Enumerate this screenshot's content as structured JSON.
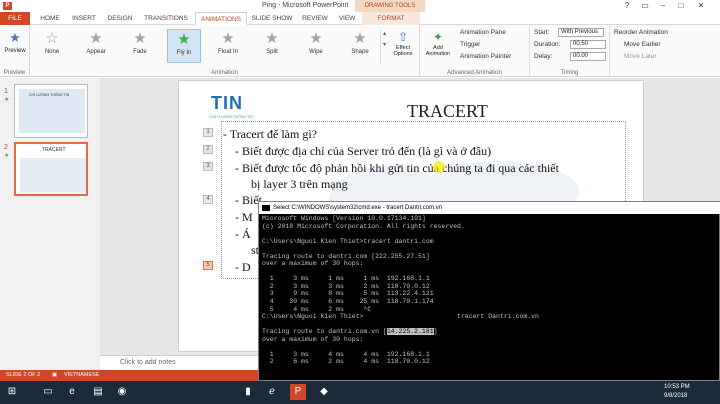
{
  "window": {
    "title": "Ping - Microsoft PowerPoint",
    "context_tab_group": "DRAWING TOOLS",
    "controls": {
      "help": "?",
      "restore": "▭",
      "minimize": "–",
      "maximize": "□",
      "close": "✕"
    }
  },
  "tabs": [
    "FILE",
    "HOME",
    "INSERT",
    "DESIGN",
    "TRANSITIONS",
    "ANIMATIONS",
    "SLIDE SHOW",
    "REVIEW",
    "VIEW",
    "FORMAT"
  ],
  "ribbon": {
    "preview": {
      "label": "Preview",
      "group": "Preview"
    },
    "animations": [
      "None",
      "Appear",
      "Fade",
      "Fly In",
      "Float In",
      "Split",
      "Wipe",
      "Shape"
    ],
    "selected_animation": "Fly In",
    "effect_options": "Effect Options",
    "animation_group": "Animation",
    "add_animation": "Add Animation",
    "animation_pane": "Animation Pane",
    "trigger": "Trigger",
    "animation_painter": "Animation Painter",
    "advanced_group": "Advanced Animation",
    "start_label": "Start:",
    "start_value": "With Previous",
    "duration_label": "Duration:",
    "duration_value": "00.50",
    "delay_label": "Delay:",
    "delay_value": "00.00",
    "reorder_label": "Reorder Animation",
    "move_earlier": "Move Earlier",
    "move_later": "Move Later",
    "timing_group": "Timing"
  },
  "thumbnails": [
    {
      "number": "1",
      "marker": "★",
      "title": "CHỈ LƯỜNG THÔNG TIN"
    },
    {
      "number": "2",
      "marker": "★",
      "title": "TRACERT"
    }
  ],
  "slide": {
    "title": "TRACERT",
    "logo_text": "TIN",
    "logo_caption": "CHẤT LƯỢNG THÔNG TIN",
    "bullets": [
      "-  Tracert để làm gì?",
      "-  Biết được địa chỉ của Server trỏ đến (là gì và ở đâu)",
      "-  Biết được tốc độ phản hồi khi gửi tin của chúng ta đi qua các thiết",
      "bị layer 3 trên mạng",
      "-  Biết",
      "-  M",
      "-  Á",
      "st",
      "-  D"
    ],
    "anim_numbers": [
      "1",
      "2",
      "3",
      "4",
      "5"
    ],
    "notes_placeholder": "Click to add notes"
  },
  "statusbar": {
    "slide": "SLIDE 2 OF 2",
    "language": "VIETNAMESE"
  },
  "taskbar": {
    "time": "10:53 PM",
    "date": "9/8/2018"
  },
  "cmd": {
    "title": "Select C:\\WINDOWS\\system32\\cmd.exe - tracert  Dantri.com.vn",
    "lines": [
      "Microsoft Windows [Version 10.0.17134.191]",
      "(c) 2018 Microsoft Corporation. All rights reserved.",
      "",
      "C:\\Users\\Nguoi Kien Thiet>tracert dantri.com",
      "",
      "Tracing route to dantri.com [222.255.27.51]",
      "over a maximum of 30 hops:",
      "",
      "  1     3 ms     1 ms     1 ms  192.168.1.1",
      "  2     3 ms     3 ms     2 ms  118.70.0.12",
      "  3     9 ms     8 ms     5 ms  113.22.4.121",
      "  4    30 ms     6 ms    25 ms  118.70.1.174",
      "  5     4 ms     2 ms     ^C",
      "C:\\Users\\Nguoi Kien Thiet>                        tracert Dantri.com.vn",
      "",
      "Tracing route to dantri.com.vn [14.225.2.181]",
      "over a maximum of 30 hops:",
      "",
      "  1     3 ms     4 ms     4 ms  192.168.1.1",
      "  2     6 ms     2 ms     4 ms  118.70.0.12"
    ],
    "highlight": "14.225.2.181"
  }
}
